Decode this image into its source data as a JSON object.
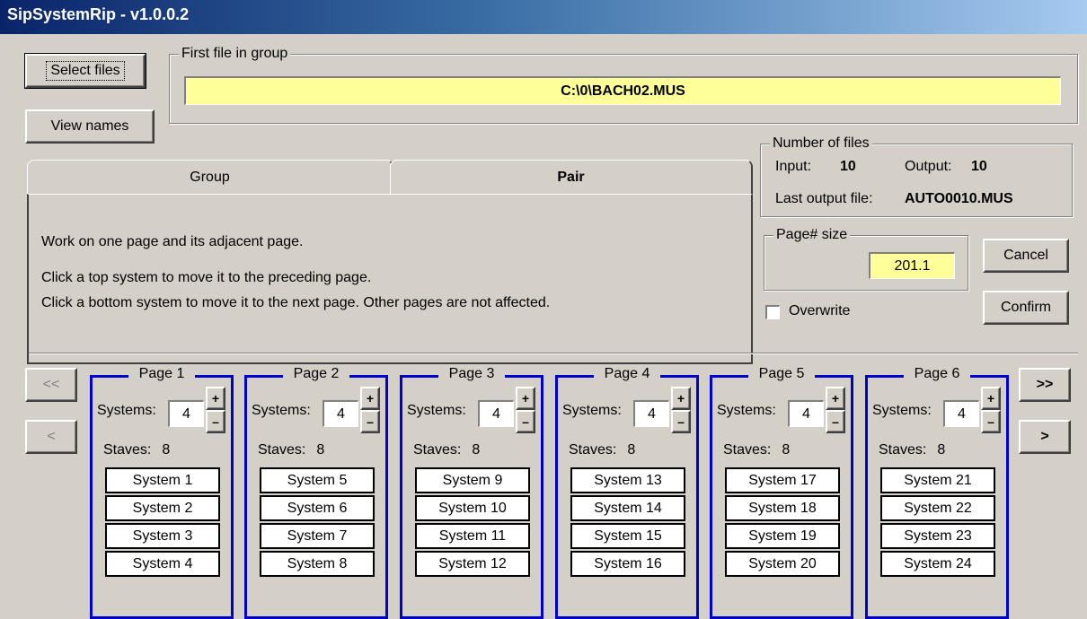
{
  "window": {
    "title": "SipSystemRip - v1.0.0.2"
  },
  "buttons": {
    "select_files": "Select files",
    "view_names": "View names",
    "cancel": "Cancel",
    "confirm": "Confirm",
    "first": "<<",
    "prev": "<",
    "last": ">>",
    "next": ">"
  },
  "first_file": {
    "legend": "First file in group",
    "value": "C:\\0\\BACH02.MUS"
  },
  "num_files": {
    "legend": "Number of files",
    "input_label": "Input:",
    "input_value": "10",
    "output_label": "Output:",
    "output_value": "10",
    "last_label": "Last output file:",
    "last_value": "AUTO0010.MUS"
  },
  "page_size": {
    "legend": "Page# size",
    "value": "201.1"
  },
  "overwrite": {
    "label": "Overwrite",
    "checked": false
  },
  "tabs": [
    {
      "label": "Group",
      "active": false
    },
    {
      "label": "Pair",
      "active": true
    }
  ],
  "pair_text": {
    "line1": "Work on one page and its adjacent page.",
    "line2": "Click a top system to move it to the preceding page.",
    "line3": "Click a bottom system to move it to the next page. Other pages are not affected."
  },
  "pages": [
    {
      "title": "Page 1",
      "systems_label": "Systems:",
      "systems": "4",
      "staves_label": "Staves:",
      "staves": "8",
      "items": [
        "System 1",
        "System 2",
        "System 3",
        "System 4"
      ]
    },
    {
      "title": "Page 2",
      "systems_label": "Systems:",
      "systems": "4",
      "staves_label": "Staves:",
      "staves": "8",
      "items": [
        "System 5",
        "System 6",
        "System 7",
        "System 8"
      ]
    },
    {
      "title": "Page 3",
      "systems_label": "Systems:",
      "systems": "4",
      "staves_label": "Staves:",
      "staves": "8",
      "items": [
        "System 9",
        "System 10",
        "System 11",
        "System 12"
      ]
    },
    {
      "title": "Page 4",
      "systems_label": "Systems:",
      "systems": "4",
      "staves_label": "Staves:",
      "staves": "8",
      "items": [
        "System 13",
        "System 14",
        "System 15",
        "System 16"
      ]
    },
    {
      "title": "Page 5",
      "systems_label": "Systems:",
      "systems": "4",
      "staves_label": "Staves:",
      "staves": "8",
      "items": [
        "System 17",
        "System 18",
        "System 19",
        "System 20"
      ]
    },
    {
      "title": "Page 6",
      "systems_label": "Systems:",
      "systems": "4",
      "staves_label": "Staves:",
      "staves": "8",
      "items": [
        "System 21",
        "System 22",
        "System 23",
        "System 24"
      ]
    }
  ],
  "spin": {
    "plus": "+",
    "minus": "–"
  },
  "colors": {
    "title_start": "#0a246a",
    "highlight": "#ffff99",
    "page_border": "#0000cc"
  }
}
